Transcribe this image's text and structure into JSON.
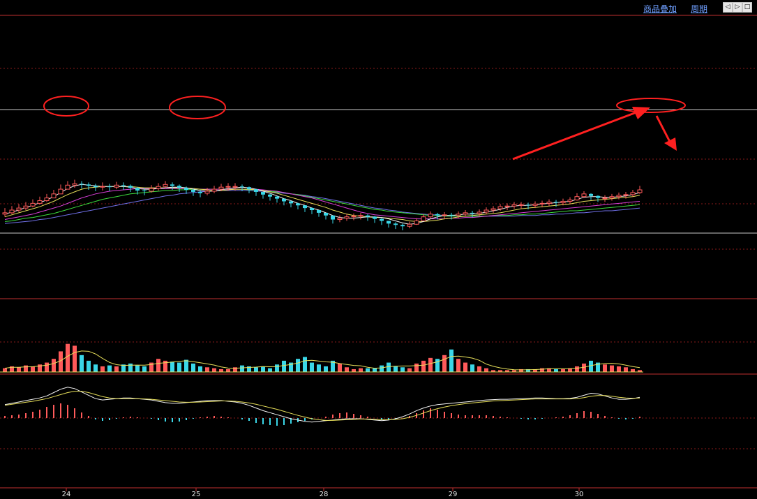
{
  "toolbar": {
    "overlay_label": "商品叠加",
    "period_label": "周期",
    "btn_left": "◁",
    "btn_right": "▷",
    "btn_close": "□"
  },
  "colors": {
    "background": "#000000",
    "up": "#ff5a5a",
    "down": "#3ad7e8",
    "ma5": "#f5f5f5",
    "ma10": "#e8e05a",
    "ma20": "#d93fd9",
    "ma40": "#3ddc3d",
    "ma60": "#7070e8",
    "grid": "#8a1a1a",
    "separator": "#c03030",
    "annotation": "#ff2020",
    "axis_text": "#e8e8e8"
  },
  "chart_data": {
    "type": "candlestick",
    "x_labels": [
      "24",
      "25",
      "28",
      "29",
      "30"
    ],
    "y_range": [
      0,
      100
    ],
    "series": {
      "close": [
        20,
        24,
        27,
        30,
        34,
        38,
        42,
        48,
        55,
        61,
        63,
        62,
        60,
        58,
        59,
        58,
        61,
        60,
        57,
        53,
        52,
        56,
        59,
        62,
        60,
        57,
        54,
        51,
        49,
        52,
        55,
        58,
        59,
        59,
        58,
        55,
        51,
        47,
        44,
        41,
        37,
        34,
        31,
        27,
        24,
        20,
        16,
        10,
        12,
        14,
        15,
        16,
        14,
        11,
        8,
        4,
        2,
        0,
        3,
        8,
        14,
        18,
        16,
        17,
        16,
        18,
        20,
        19,
        21,
        24,
        26,
        29,
        30,
        32,
        32,
        31,
        33,
        34,
        36,
        35,
        37,
        39,
        44,
        48,
        45,
        42,
        42,
        44,
        46,
        47,
        50,
        54
      ],
      "high": [
        27,
        30,
        33,
        36,
        40,
        44,
        48,
        54,
        62,
        67,
        69,
        67,
        65,
        63,
        65,
        63,
        66,
        65,
        62,
        58,
        57,
        61,
        64,
        67,
        65,
        62,
        59,
        56,
        54,
        57,
        60,
        63,
        64,
        64,
        62,
        59,
        55,
        51,
        48,
        45,
        41,
        38,
        35,
        31,
        28,
        24,
        20,
        14,
        16,
        18,
        19,
        20,
        18,
        15,
        12,
        8,
        6,
        4,
        7,
        12,
        18,
        22,
        20,
        21,
        20,
        22,
        24,
        23,
        25,
        28,
        30,
        33,
        34,
        36,
        36,
        35,
        37,
        38,
        40,
        39,
        41,
        43,
        49,
        52,
        49,
        46,
        46,
        48,
        50,
        51,
        54,
        60
      ],
      "low": [
        14,
        18,
        21,
        24,
        28,
        32,
        36,
        42,
        49,
        55,
        57,
        56,
        54,
        52,
        53,
        52,
        55,
        54,
        51,
        47,
        46,
        50,
        53,
        56,
        54,
        51,
        48,
        45,
        43,
        46,
        49,
        52,
        53,
        53,
        52,
        49,
        45,
        41,
        38,
        35,
        31,
        28,
        25,
        21,
        18,
        14,
        10,
        4,
        6,
        8,
        9,
        10,
        8,
        5,
        2,
        -2,
        -4,
        -6,
        -3,
        2,
        8,
        12,
        10,
        11,
        10,
        12,
        14,
        13,
        15,
        18,
        20,
        23,
        24,
        26,
        26,
        25,
        27,
        28,
        30,
        29,
        31,
        33,
        38,
        42,
        39,
        36,
        36,
        38,
        40,
        41,
        44,
        48
      ],
      "ma5": [
        18,
        21,
        24,
        28,
        31,
        35,
        39,
        44,
        50,
        56,
        60,
        62,
        61,
        60,
        59,
        59,
        59,
        59,
        58,
        56,
        55,
        55,
        56,
        57,
        58,
        58,
        57,
        55,
        53,
        52,
        52,
        54,
        56,
        57,
        58,
        57,
        55,
        52,
        49,
        45,
        41,
        38,
        34,
        31,
        27,
        24,
        20,
        16,
        13,
        12,
        12,
        13,
        14,
        14,
        13,
        11,
        8,
        5,
        3,
        4,
        7,
        11,
        14,
        16,
        16,
        17,
        18,
        18,
        19,
        21,
        23,
        25,
        28,
        30,
        31,
        31,
        32,
        33,
        34,
        35,
        36,
        37,
        40,
        43,
        44,
        44,
        43,
        43,
        44,
        45,
        47,
        50
      ],
      "ma10": [
        14,
        17,
        20,
        23,
        26,
        29,
        33,
        37,
        42,
        47,
        51,
        55,
        57,
        58,
        59,
        59,
        59,
        59,
        59,
        58,
        57,
        57,
        57,
        57,
        57,
        57,
        57,
        56,
        55,
        54,
        53,
        53,
        54,
        55,
        55,
        55,
        54,
        53,
        51,
        49,
        46,
        43,
        40,
        37,
        34,
        31,
        28,
        24,
        21,
        18,
        16,
        15,
        14,
        13,
        13,
        12,
        11,
        10,
        8,
        7,
        7,
        8,
        9,
        11,
        12,
        14,
        15,
        16,
        17,
        18,
        19,
        20,
        22,
        24,
        26,
        27,
        28,
        29,
        30,
        31,
        32,
        33,
        35,
        37,
        38,
        39,
        40,
        41,
        42,
        43,
        44,
        46
      ],
      "ma20": [
        10,
        12,
        14,
        16,
        18,
        21,
        24,
        27,
        30,
        34,
        38,
        42,
        45,
        48,
        50,
        52,
        53,
        54,
        55,
        56,
        56,
        56,
        56,
        56,
        56,
        56,
        56,
        56,
        55,
        55,
        55,
        55,
        55,
        55,
        55,
        55,
        55,
        54,
        53,
        52,
        50,
        48,
        46,
        44,
        42,
        39,
        36,
        33,
        30,
        27,
        24,
        21,
        19,
        17,
        16,
        15,
        14,
        13,
        12,
        11,
        11,
        11,
        11,
        11,
        12,
        12,
        13,
        13,
        14,
        15,
        16,
        17,
        18,
        19,
        20,
        21,
        22,
        23,
        24,
        25,
        26,
        27,
        28,
        29,
        30,
        31,
        32,
        33,
        34,
        35,
        36,
        37
      ],
      "ma40": [
        7,
        8,
        10,
        12,
        13,
        15,
        17,
        19,
        22,
        25,
        28,
        31,
        34,
        37,
        40,
        42,
        44,
        46,
        48,
        49,
        50,
        51,
        52,
        53,
        53,
        54,
        54,
        55,
        55,
        55,
        55,
        55,
        55,
        55,
        55,
        54,
        54,
        53,
        52,
        51,
        50,
        48,
        47,
        45,
        43,
        41,
        39,
        37,
        35,
        33,
        31,
        29,
        27,
        25,
        24,
        22,
        21,
        20,
        19,
        18,
        17,
        16,
        16,
        15,
        15,
        15,
        15,
        15,
        15,
        15,
        16,
        16,
        16,
        17,
        17,
        18,
        18,
        19,
        20,
        21,
        22,
        23,
        23,
        24,
        25,
        26,
        27,
        28,
        29,
        30,
        31,
        32
      ],
      "ma60": [
        4,
        5,
        6,
        7,
        8,
        10,
        11,
        13,
        15,
        17,
        19,
        21,
        23,
        25,
        27,
        29,
        31,
        33,
        35,
        37,
        39,
        41,
        43,
        45,
        46,
        48,
        49,
        50,
        51,
        52,
        52,
        53,
        53,
        53,
        53,
        53,
        52,
        52,
        51,
        50,
        49,
        48,
        47,
        46,
        44,
        43,
        41,
        39,
        37,
        35,
        33,
        31,
        29,
        27,
        26,
        24,
        23,
        21,
        20,
        19,
        18,
        17,
        17,
        16,
        16,
        15,
        15,
        15,
        15,
        15,
        15,
        15,
        15,
        15,
        16,
        16,
        16,
        17,
        17,
        18,
        18,
        19,
        20,
        20,
        21,
        22,
        23,
        23,
        24,
        25,
        26,
        27
      ],
      "volume": [
        4,
        6,
        5,
        7,
        6,
        8,
        10,
        14,
        22,
        30,
        28,
        18,
        12,
        8,
        6,
        7,
        6,
        8,
        9,
        7,
        6,
        10,
        14,
        12,
        11,
        10,
        13,
        9,
        6,
        5,
        4,
        3,
        3,
        5,
        7,
        6,
        5,
        6,
        4,
        8,
        12,
        10,
        14,
        16,
        10,
        8,
        6,
        12,
        9,
        5,
        3,
        4,
        4,
        4,
        7,
        10,
        6,
        5,
        4,
        9,
        12,
        15,
        14,
        18,
        24,
        14,
        10,
        8,
        6,
        4,
        2,
        2,
        2,
        2,
        3,
        3,
        3,
        4,
        4,
        3,
        3,
        4,
        6,
        9,
        12,
        10,
        8,
        7,
        6,
        5,
        3,
        2
      ],
      "macd_hist": [
        3,
        4,
        5,
        7,
        9,
        12,
        16,
        19,
        21,
        19,
        14,
        8,
        3,
        -2,
        -4,
        -3,
        -1,
        1,
        2,
        1,
        0,
        -1,
        -3,
        -5,
        -6,
        -5,
        -3,
        -1,
        1,
        2,
        3,
        2,
        1,
        0,
        -2,
        -4,
        -7,
        -9,
        -10,
        -11,
        -10,
        -8,
        -6,
        -4,
        -2,
        0,
        2,
        5,
        7,
        8,
        6,
        4,
        2,
        0,
        -2,
        -3,
        -2,
        0,
        3,
        7,
        11,
        14,
        12,
        9,
        7,
        5,
        4,
        4,
        4,
        4,
        3,
        2,
        1,
        0,
        -1,
        -2,
        -2,
        -1,
        0,
        1,
        2,
        4,
        7,
        10,
        9,
        6,
        3,
        1,
        -1,
        -2,
        -1,
        2
      ],
      "dif": [
        40,
        44,
        48,
        52,
        56,
        60,
        66,
        76,
        86,
        92,
        88,
        78,
        68,
        58,
        54,
        56,
        58,
        60,
        60,
        58,
        56,
        54,
        50,
        46,
        44,
        44,
        46,
        48,
        50,
        52,
        52,
        52,
        50,
        48,
        44,
        38,
        30,
        22,
        16,
        10,
        4,
        -2,
        -6,
        -10,
        -12,
        -10,
        -8,
        -6,
        -4,
        -2,
        -2,
        -2,
        -4,
        -6,
        -8,
        -6,
        -2,
        4,
        12,
        22,
        30,
        36,
        40,
        42,
        44,
        46,
        48,
        50,
        52,
        54,
        55,
        56,
        56,
        57,
        58,
        59,
        60,
        60,
        59,
        58,
        58,
        59,
        62,
        68,
        74,
        72,
        66,
        60,
        56,
        56,
        58,
        62
      ],
      "dea": [
        38,
        41,
        44,
        47,
        50,
        54,
        58,
        64,
        70,
        76,
        80,
        80,
        76,
        70,
        64,
        60,
        58,
        58,
        58,
        58,
        57,
        56,
        54,
        52,
        50,
        48,
        47,
        47,
        48,
        49,
        50,
        51,
        51,
        50,
        48,
        45,
        41,
        36,
        31,
        26,
        20,
        14,
        8,
        3,
        -2,
        -5,
        -7,
        -7,
        -6,
        -5,
        -4,
        -3,
        -3,
        -4,
        -5,
        -5,
        -4,
        -2,
        2,
        8,
        15,
        22,
        28,
        33,
        37,
        40,
        43,
        45,
        47,
        49,
        51,
        52,
        53,
        54,
        55,
        56,
        57,
        57,
        57,
        57,
        57,
        57,
        58,
        61,
        65,
        67,
        67,
        65,
        62,
        60,
        59,
        60
      ]
    }
  }
}
